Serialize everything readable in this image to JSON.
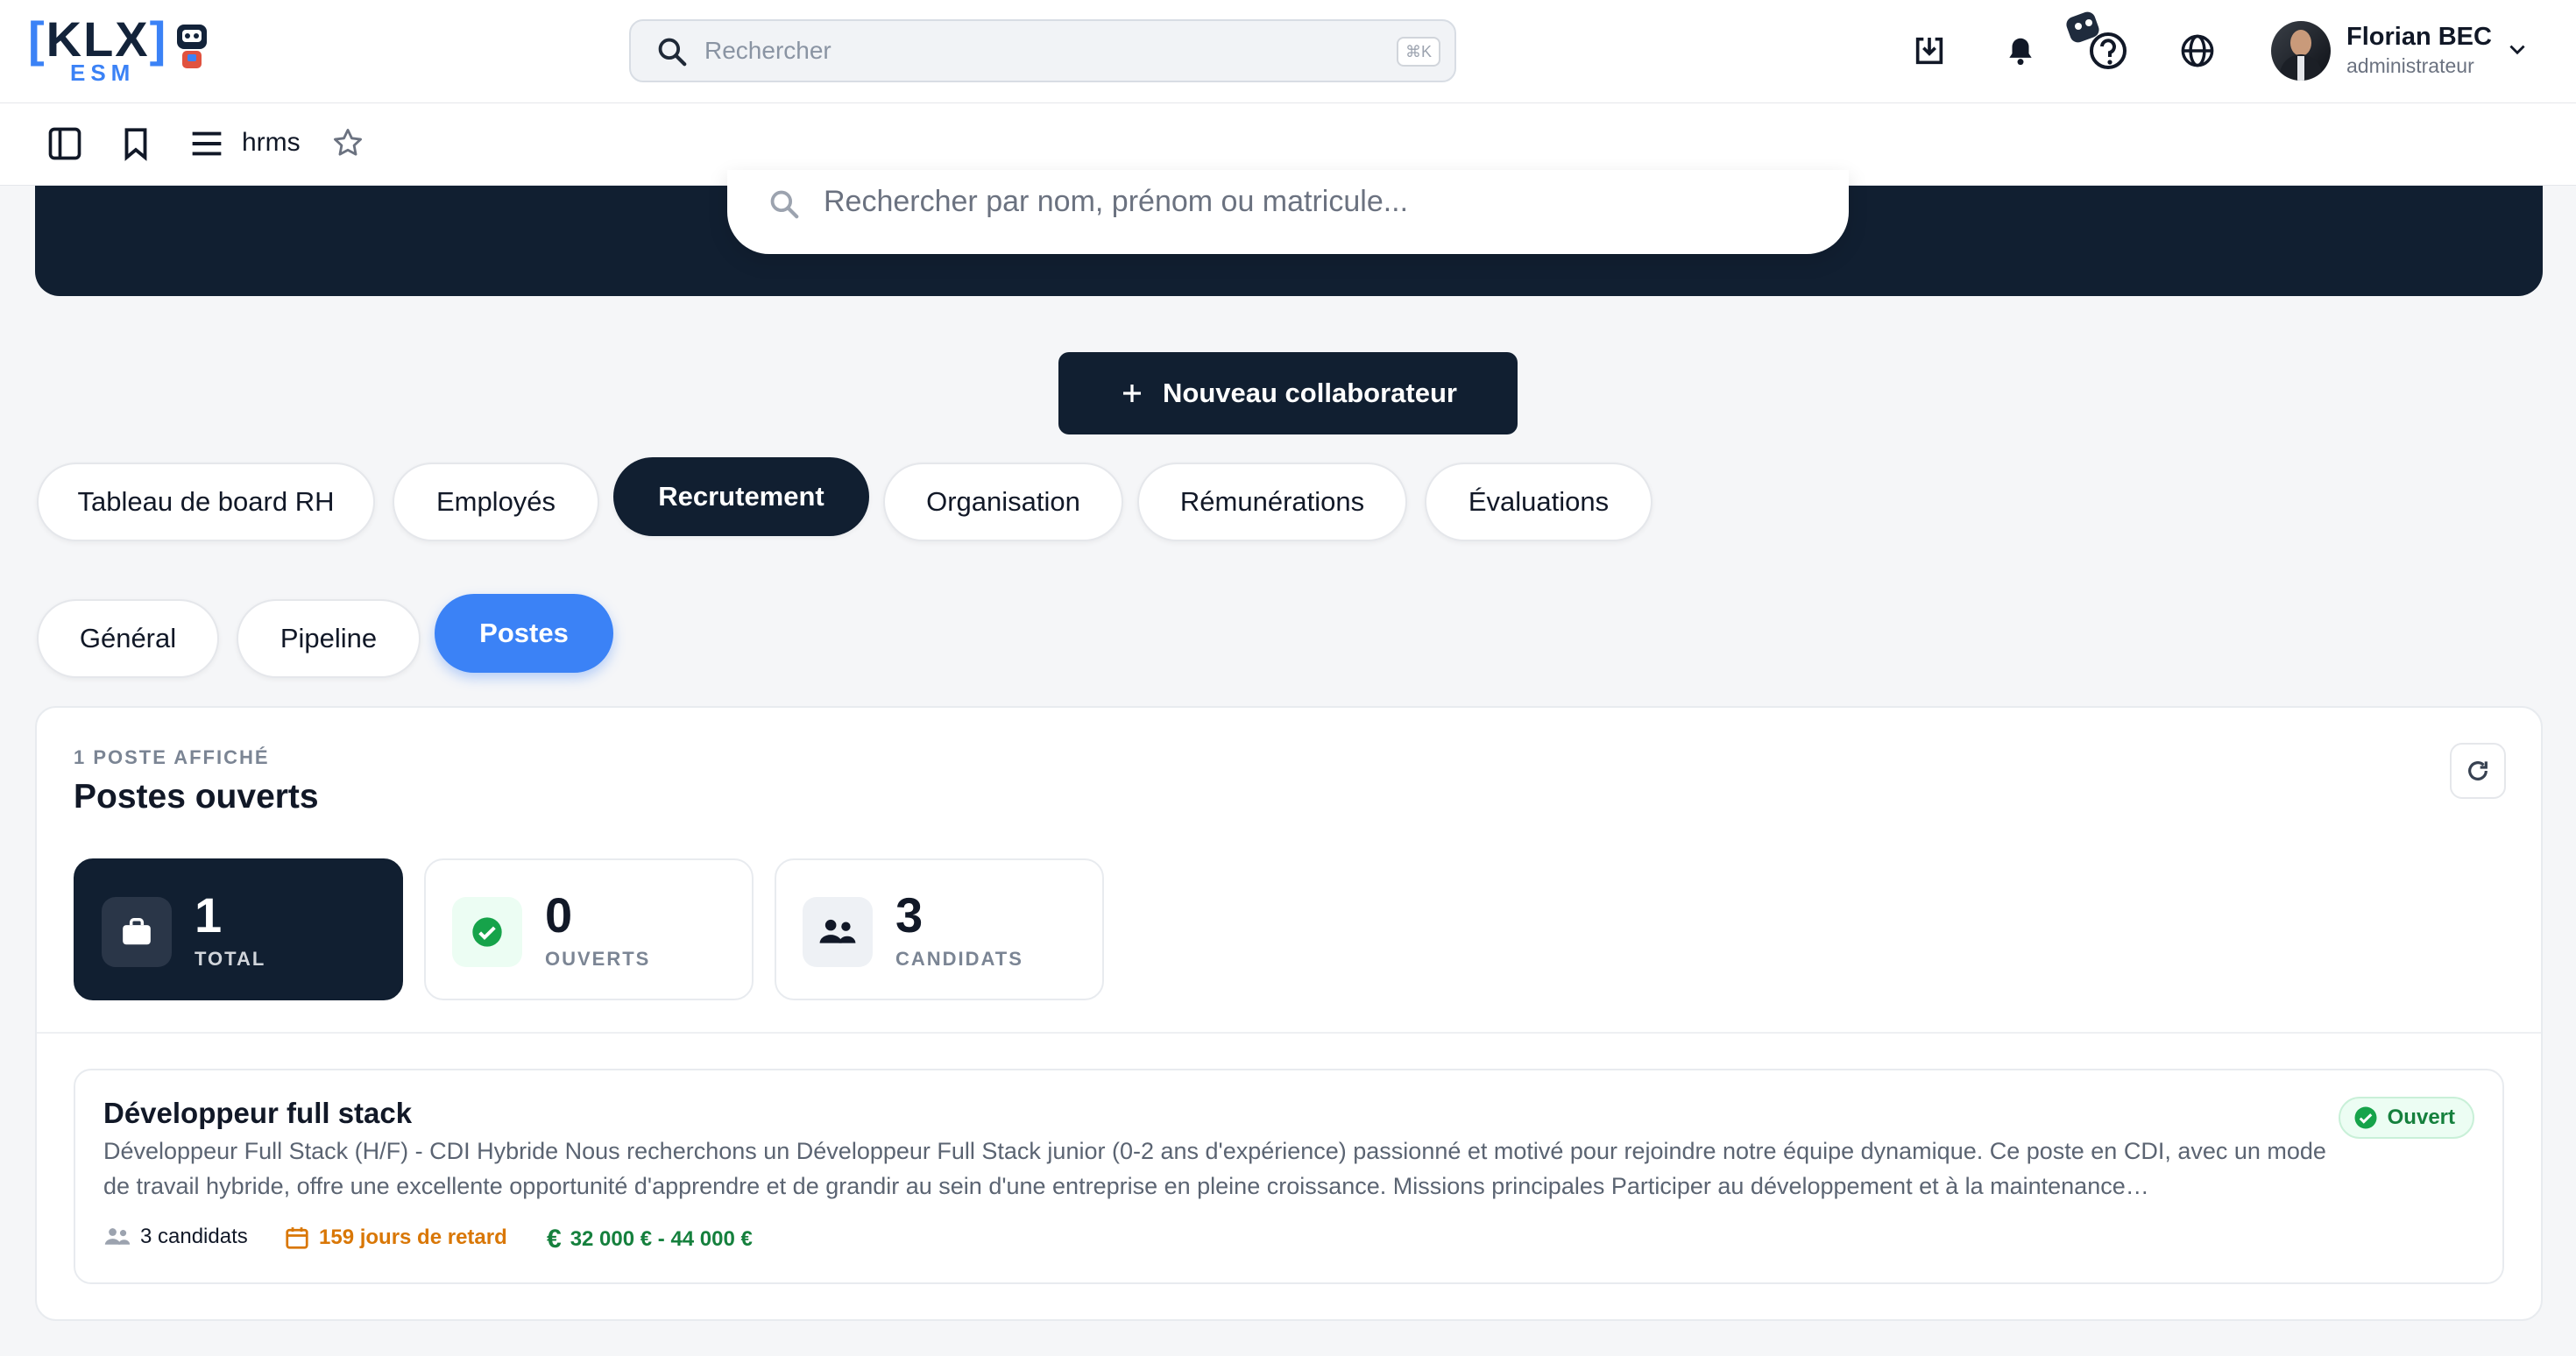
{
  "header": {
    "logo_text": "KLX",
    "logo_sub": "ESM",
    "search_placeholder": "Rechercher",
    "search_shortcut": "⌘K",
    "user_name": "Florian BEC",
    "user_role": "administrateur"
  },
  "subbar": {
    "breadcrumb": "hrms"
  },
  "hero": {
    "search_placeholder": "Rechercher par nom, prénom ou matricule..."
  },
  "actions": {
    "new_label": "Nouveau collaborateur"
  },
  "main_tabs": [
    {
      "label": "Tableau de board RH",
      "active": false
    },
    {
      "label": "Employés",
      "active": false
    },
    {
      "label": "Recrutement",
      "active": true
    },
    {
      "label": "Organisation",
      "active": false
    },
    {
      "label": "Rémunérations",
      "active": false
    },
    {
      "label": "Évaluations",
      "active": false
    }
  ],
  "sub_tabs": [
    {
      "label": "Général",
      "active": false
    },
    {
      "label": "Pipeline",
      "active": false
    },
    {
      "label": "Postes",
      "active": true
    }
  ],
  "card": {
    "eyebrow": "1 POSTE AFFICHÉ",
    "title": "Postes ouverts",
    "stats": [
      {
        "value": "1",
        "label": "TOTAL",
        "icon": "briefcase-icon"
      },
      {
        "value": "0",
        "label": "OUVERTS",
        "icon": "check-circle-icon"
      },
      {
        "value": "3",
        "label": "CANDIDATS",
        "icon": "people-icon"
      }
    ]
  },
  "job": {
    "title": "Développeur full stack",
    "description": "Développeur Full Stack (H/F) - CDI Hybride Nous recherchons un Développeur Full Stack junior (0-2 ans d'expérience) passionné et motivé pour rejoindre notre équipe dynamique. Ce poste en CDI, avec un mode de travail hybride, offre une excellente opportunité d'apprendre et de grandir au sein d'une entreprise en pleine croissance. Missions principales Participer au développement et à la maintenance…",
    "status": "Ouvert",
    "candidates": "3 candidats",
    "delay": "159 jours de retard",
    "salary": "32 000 € - 44 000 €"
  },
  "colors": {
    "navy": "#111f31",
    "accent_blue": "#3b82f6",
    "success_green": "#15803d",
    "warning_orange": "#d97706"
  }
}
